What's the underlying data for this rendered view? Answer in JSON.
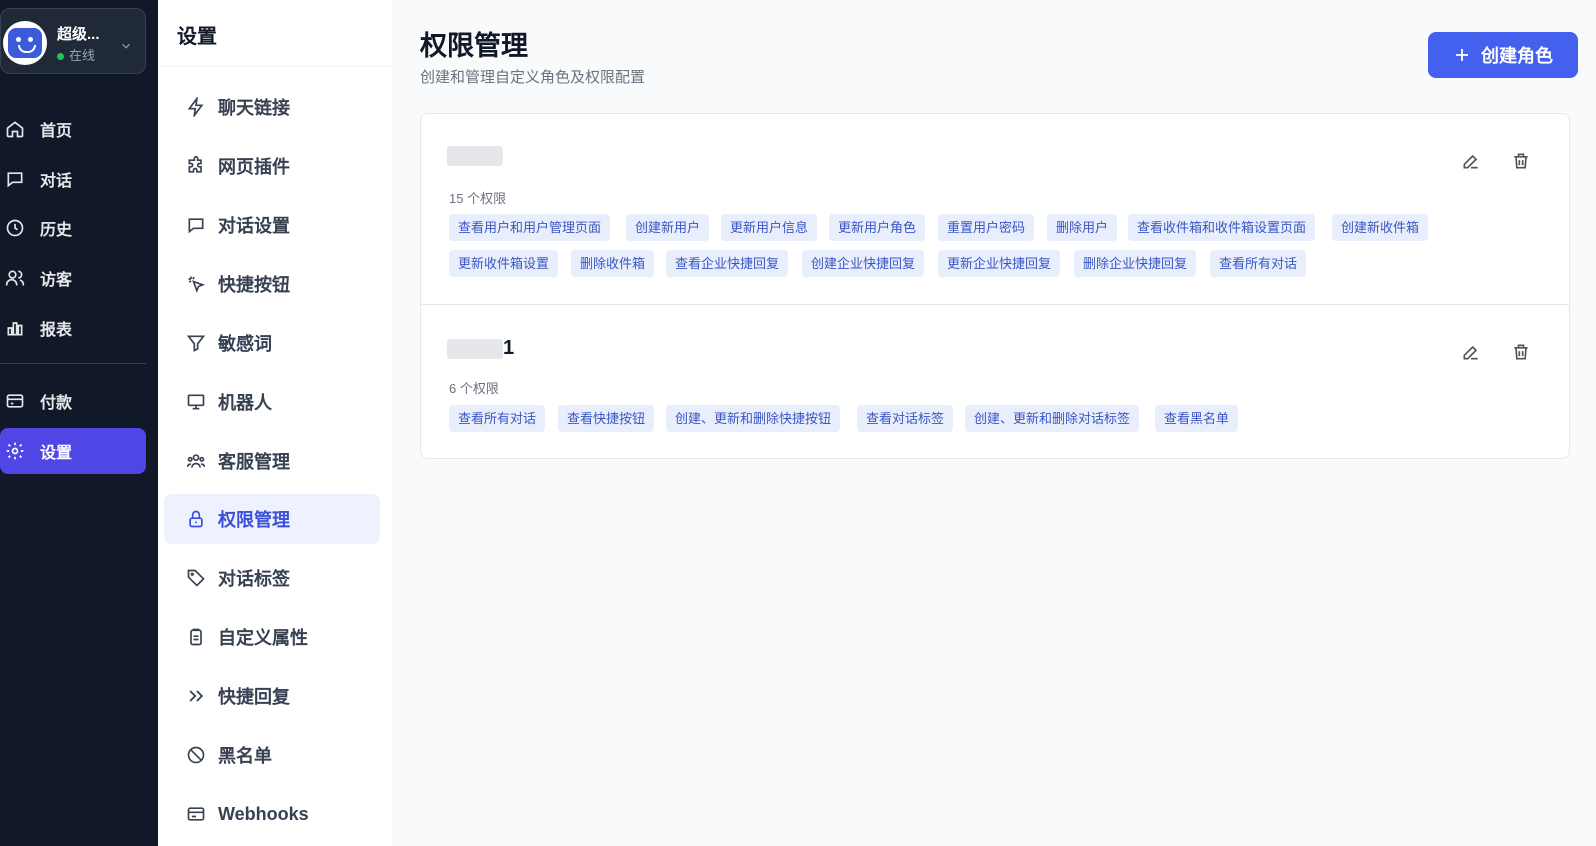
{
  "user": {
    "name": "超级...",
    "status": "在线"
  },
  "nav": {
    "items": [
      {
        "label": "首页",
        "icon": "home-icon"
      },
      {
        "label": "对话",
        "icon": "chat-icon"
      },
      {
        "label": "历史",
        "icon": "clock-icon"
      },
      {
        "label": "访客",
        "icon": "users-icon"
      },
      {
        "label": "报表",
        "icon": "chart-icon"
      },
      {
        "label": "付款",
        "icon": "credit-card-icon"
      },
      {
        "label": "设置",
        "icon": "gear-icon",
        "active": true
      }
    ]
  },
  "settings": {
    "title": "设置",
    "items": [
      {
        "label": "聊天链接",
        "icon": "bolt-icon"
      },
      {
        "label": "网页插件",
        "icon": "puzzle-icon"
      },
      {
        "label": "对话设置",
        "icon": "chat-icon"
      },
      {
        "label": "快捷按钮",
        "icon": "cursor-click-icon"
      },
      {
        "label": "敏感词",
        "icon": "filter-icon"
      },
      {
        "label": "机器人",
        "icon": "monitor-icon"
      },
      {
        "label": "客服管理",
        "icon": "team-icon"
      },
      {
        "label": "权限管理",
        "icon": "lock-icon",
        "active": true
      },
      {
        "label": "对话标签",
        "icon": "tag-icon"
      },
      {
        "label": "自定义属性",
        "icon": "clipboard-icon"
      },
      {
        "label": "快捷回复",
        "icon": "double-chevron-icon"
      },
      {
        "label": "黑名单",
        "icon": "ban-icon"
      },
      {
        "label": "Webhooks",
        "icon": "webhook-icon"
      }
    ]
  },
  "page": {
    "title": "权限管理",
    "subtitle": "创建和管理自定义角色及权限配置",
    "create_button": "创建角色"
  },
  "roles": [
    {
      "name": "",
      "count": "15 个权限",
      "permissions": [
        "查看用户和用户管理页面",
        "创建新用户",
        "更新用户信息",
        "更新用户角色",
        "重置用户密码",
        "删除用户",
        "查看收件箱和收件箱设置页面",
        "创建新收件箱",
        "更新收件箱设置",
        "删除收件箱",
        "查看企业快捷回复",
        "创建企业快捷回复",
        "更新企业快捷回复",
        "删除企业快捷回复",
        "查看所有对话"
      ]
    },
    {
      "name": "1",
      "count": "6 个权限",
      "permissions": [
        "查看所有对话",
        "查看快捷按钮",
        "创建、更新和删除快捷按钮",
        "查看对话标签",
        "创建、更新和删除对话标签",
        "查看黑名单"
      ]
    }
  ],
  "colors": {
    "accent": "#4361ee",
    "sidebar_bg": "#111827",
    "tag_bg": "#e8eefc",
    "tag_text": "#3a56c4"
  }
}
